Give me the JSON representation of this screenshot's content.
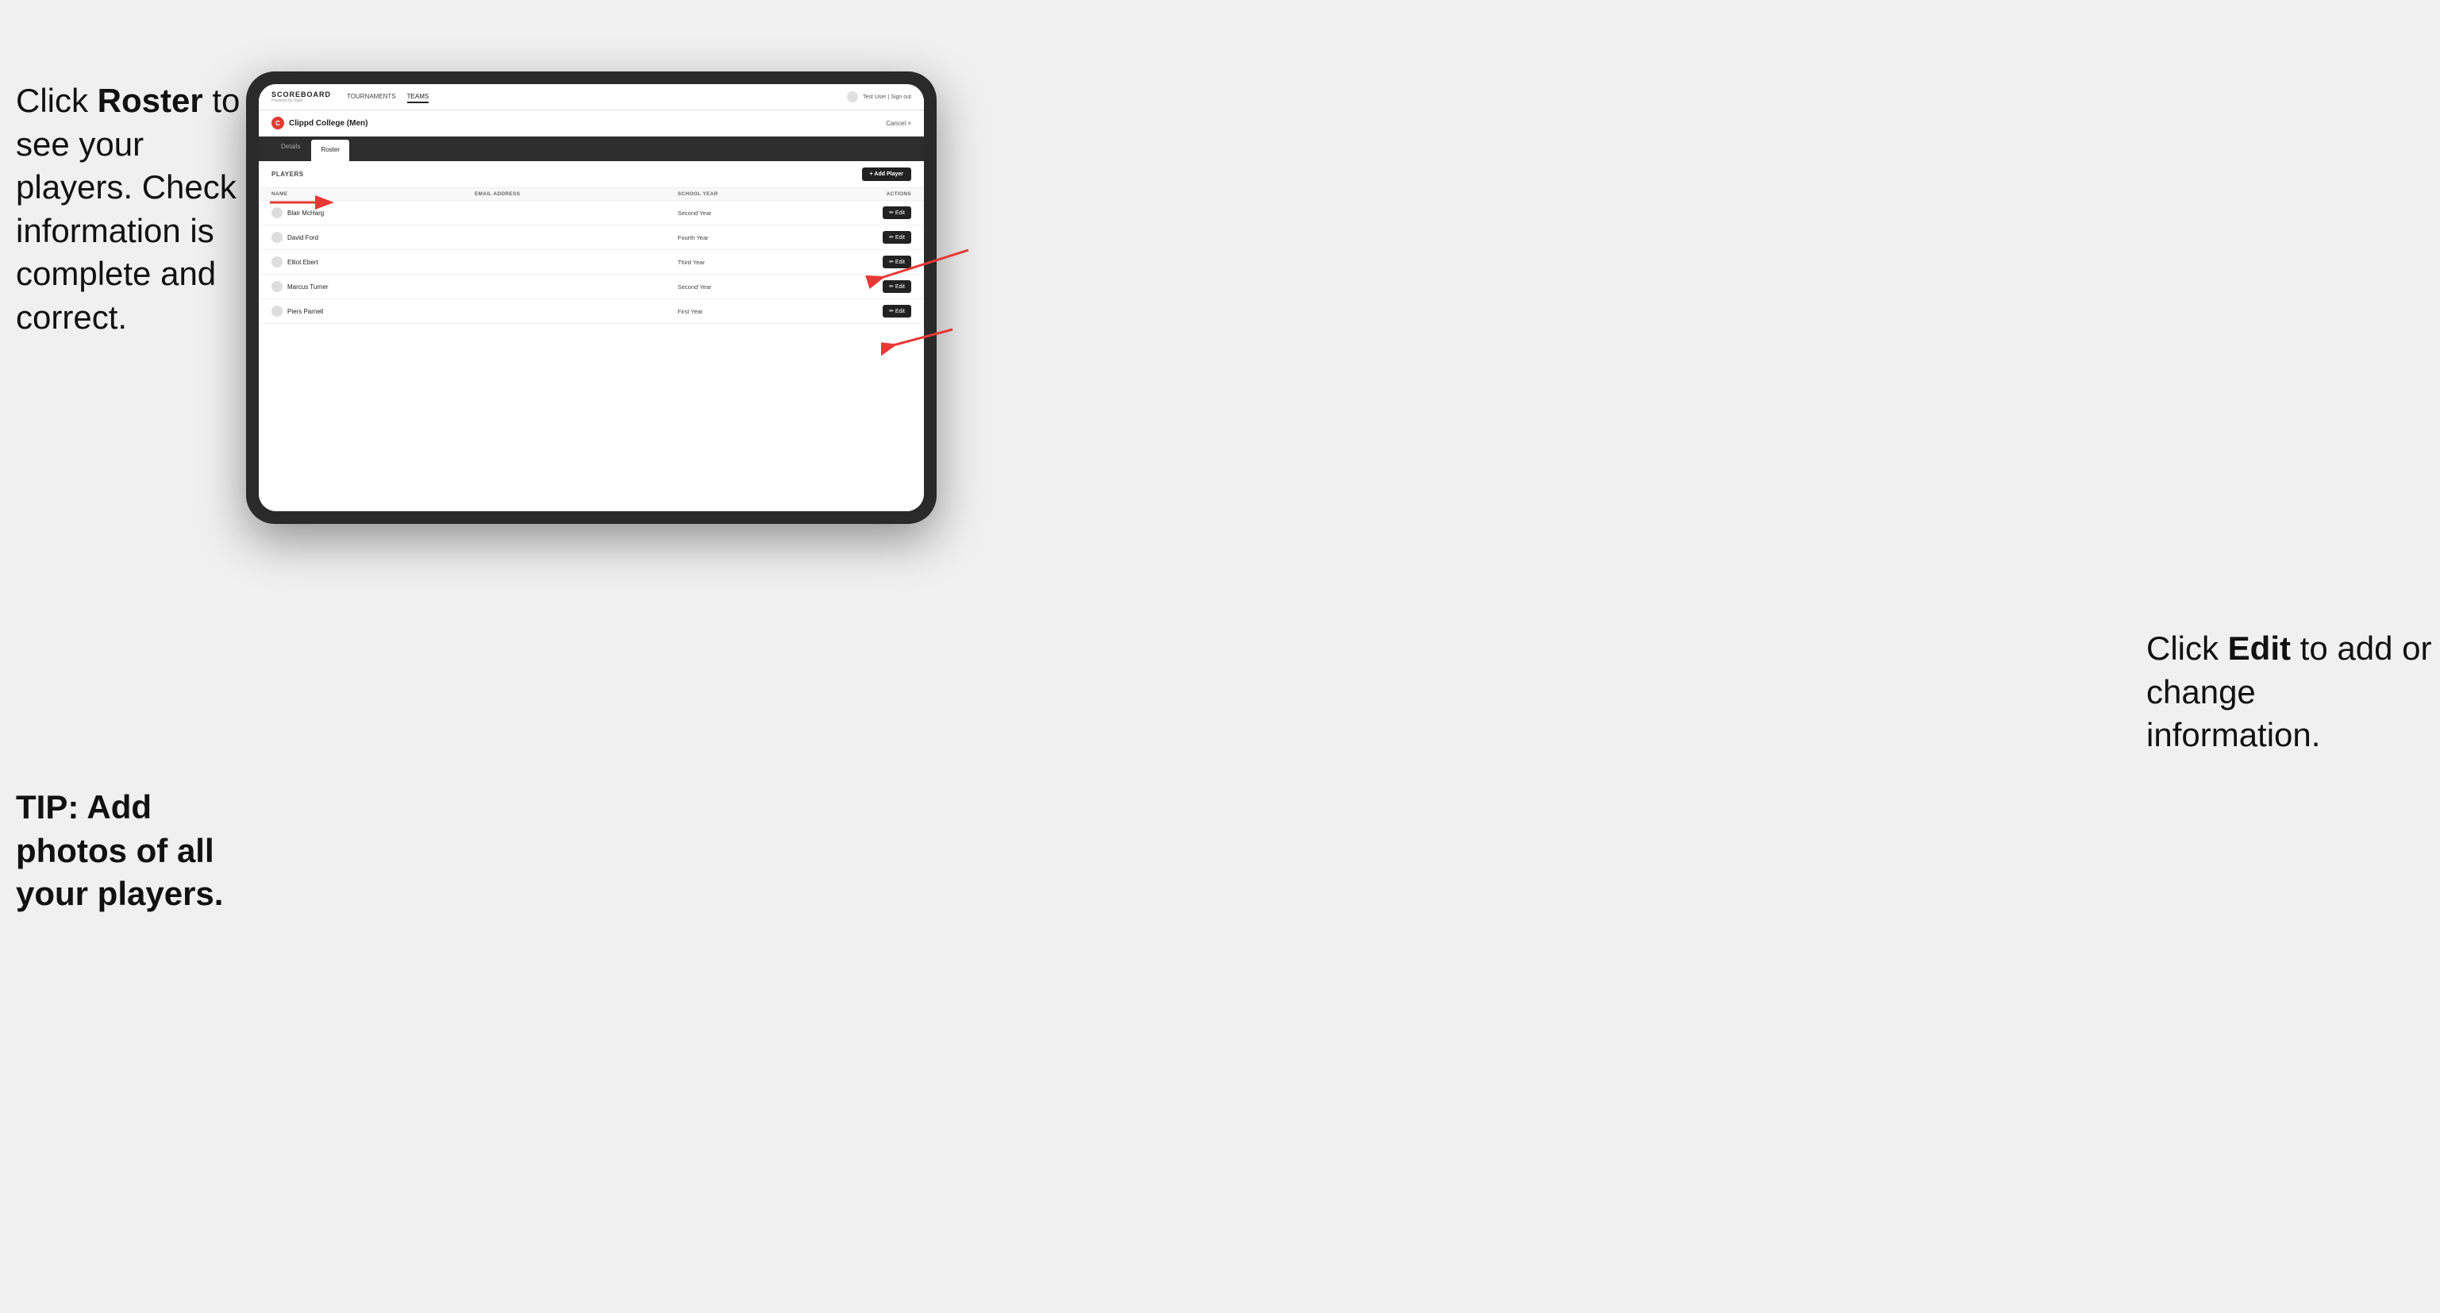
{
  "instructions": {
    "left_main": "Click ",
    "left_bold": "Roster",
    "left_rest": " to see your players. Check information is complete and correct.",
    "tip": "TIP: Add photos of all your players.",
    "right_intro": "Click ",
    "right_bold": "Edit",
    "right_rest": " to add or change information."
  },
  "nav": {
    "logo": "SCOREBOARD",
    "logo_sub": "Powered by clippi",
    "links": [
      "TOURNAMENTS",
      "TEAMS"
    ],
    "active_link": "TEAMS",
    "user_text": "Test User | Sign out"
  },
  "team": {
    "logo_letter": "C",
    "name": "Clippd College (Men)",
    "cancel_label": "Cancel ×"
  },
  "tabs": [
    {
      "label": "Details",
      "active": false
    },
    {
      "label": "Roster",
      "active": true
    }
  ],
  "players_section": {
    "title": "PLAYERS",
    "add_button": "+ Add Player",
    "columns": [
      "NAME",
      "EMAIL ADDRESS",
      "SCHOOL YEAR",
      "ACTIONS"
    ],
    "players": [
      {
        "name": "Blair McHarg",
        "email": "",
        "year": "Second Year"
      },
      {
        "name": "David Ford",
        "email": "",
        "year": "Fourth Year"
      },
      {
        "name": "Elliot Ebert",
        "email": "",
        "year": "Third Year"
      },
      {
        "name": "Marcus Turner",
        "email": "",
        "year": "Second Year"
      },
      {
        "name": "Piers Parnell",
        "email": "",
        "year": "First Year"
      }
    ],
    "edit_label": "✏ Edit"
  },
  "colors": {
    "accent": "#e53935",
    "dark": "#222222",
    "nav_bg": "#2d2d2d",
    "tab_active_bg": "#ffffff"
  }
}
